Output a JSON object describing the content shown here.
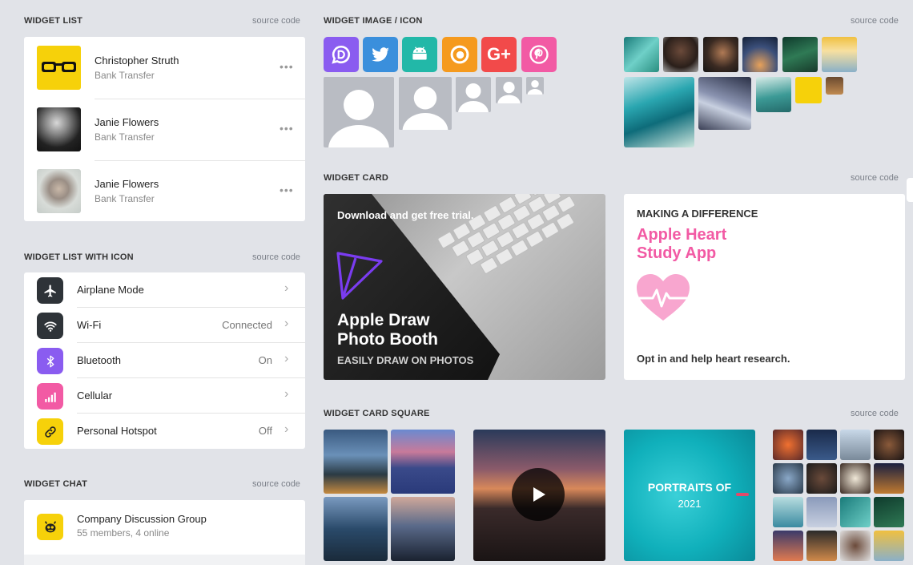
{
  "sections": {
    "widget_list": {
      "title": "WIDGET LIST",
      "source": "source code"
    },
    "widget_list_icon": {
      "title": "WIDGET LIST WITH ICON",
      "source": "source code"
    },
    "widget_chat": {
      "title": "WIDGET CHAT",
      "source": "source code"
    },
    "widget_image": {
      "title": "WIDGET IMAGE / ICON",
      "source": "source code"
    },
    "widget_card": {
      "title": "WIDGET CARD",
      "source": "source code"
    },
    "widget_card_square": {
      "title": "WIDGET CARD SQUARE",
      "source": "source code"
    }
  },
  "widget_list": {
    "items": [
      {
        "name": "Christopher Struth",
        "sub": "Bank Transfer",
        "avatar": "glasses-avatar",
        "more": "•••"
      },
      {
        "name": "Janie Flowers",
        "sub": "Bank Transfer",
        "avatar": "person-photo",
        "more": "•••"
      },
      {
        "name": "Janie Flowers",
        "sub": "Bank Transfer",
        "avatar": "person-photo",
        "more": "•••"
      }
    ]
  },
  "widget_list_icon": {
    "items": [
      {
        "label": "Airplane Mode",
        "value": "",
        "icon": "airplane-icon",
        "color": "#2e3338"
      },
      {
        "label": "Wi-Fi",
        "value": "Connected",
        "icon": "wifi-icon",
        "color": "#2e3338"
      },
      {
        "label": "Bluetooth",
        "value": "On",
        "icon": "bluetooth-icon",
        "color": "#8a5cf0"
      },
      {
        "label": "Cellular",
        "value": "",
        "icon": "cellular-icon",
        "color": "#f25aa4"
      },
      {
        "label": "Personal Hotspot",
        "value": "Off",
        "icon": "link-icon",
        "color": "#f6d10a"
      }
    ]
  },
  "widget_chat": {
    "group_name": "Company Discussion Group",
    "group_meta": "55 members, 4 online"
  },
  "social_icons": [
    {
      "name": "disqus-icon",
      "color": "#8a5cf0"
    },
    {
      "name": "twitter-icon",
      "color": "#3a8fdc"
    },
    {
      "name": "android-icon",
      "color": "#22b8a8"
    },
    {
      "name": "firefox-icon",
      "color": "#f59a1e"
    },
    {
      "name": "google-plus-icon",
      "color": "#f24a4a"
    },
    {
      "name": "pinterest-icon",
      "color": "#f25aa4"
    }
  ],
  "card_dark": {
    "top_text": "Download and get free trial.",
    "title_line1": "Apple Draw",
    "title_line2": "Photo Booth",
    "subtitle": "EASILY DRAW ON PHOTOS"
  },
  "card_white": {
    "eyebrow": "MAKING A DIFFERENCE",
    "title_line1": "Apple Heart",
    "title_line2": "Study App",
    "footer": "Opt in and help heart research.",
    "accent": "#f25aa4"
  },
  "card_square": {
    "portraits_line1": "PORTRAITS OF",
    "portraits_line2": "2021"
  }
}
